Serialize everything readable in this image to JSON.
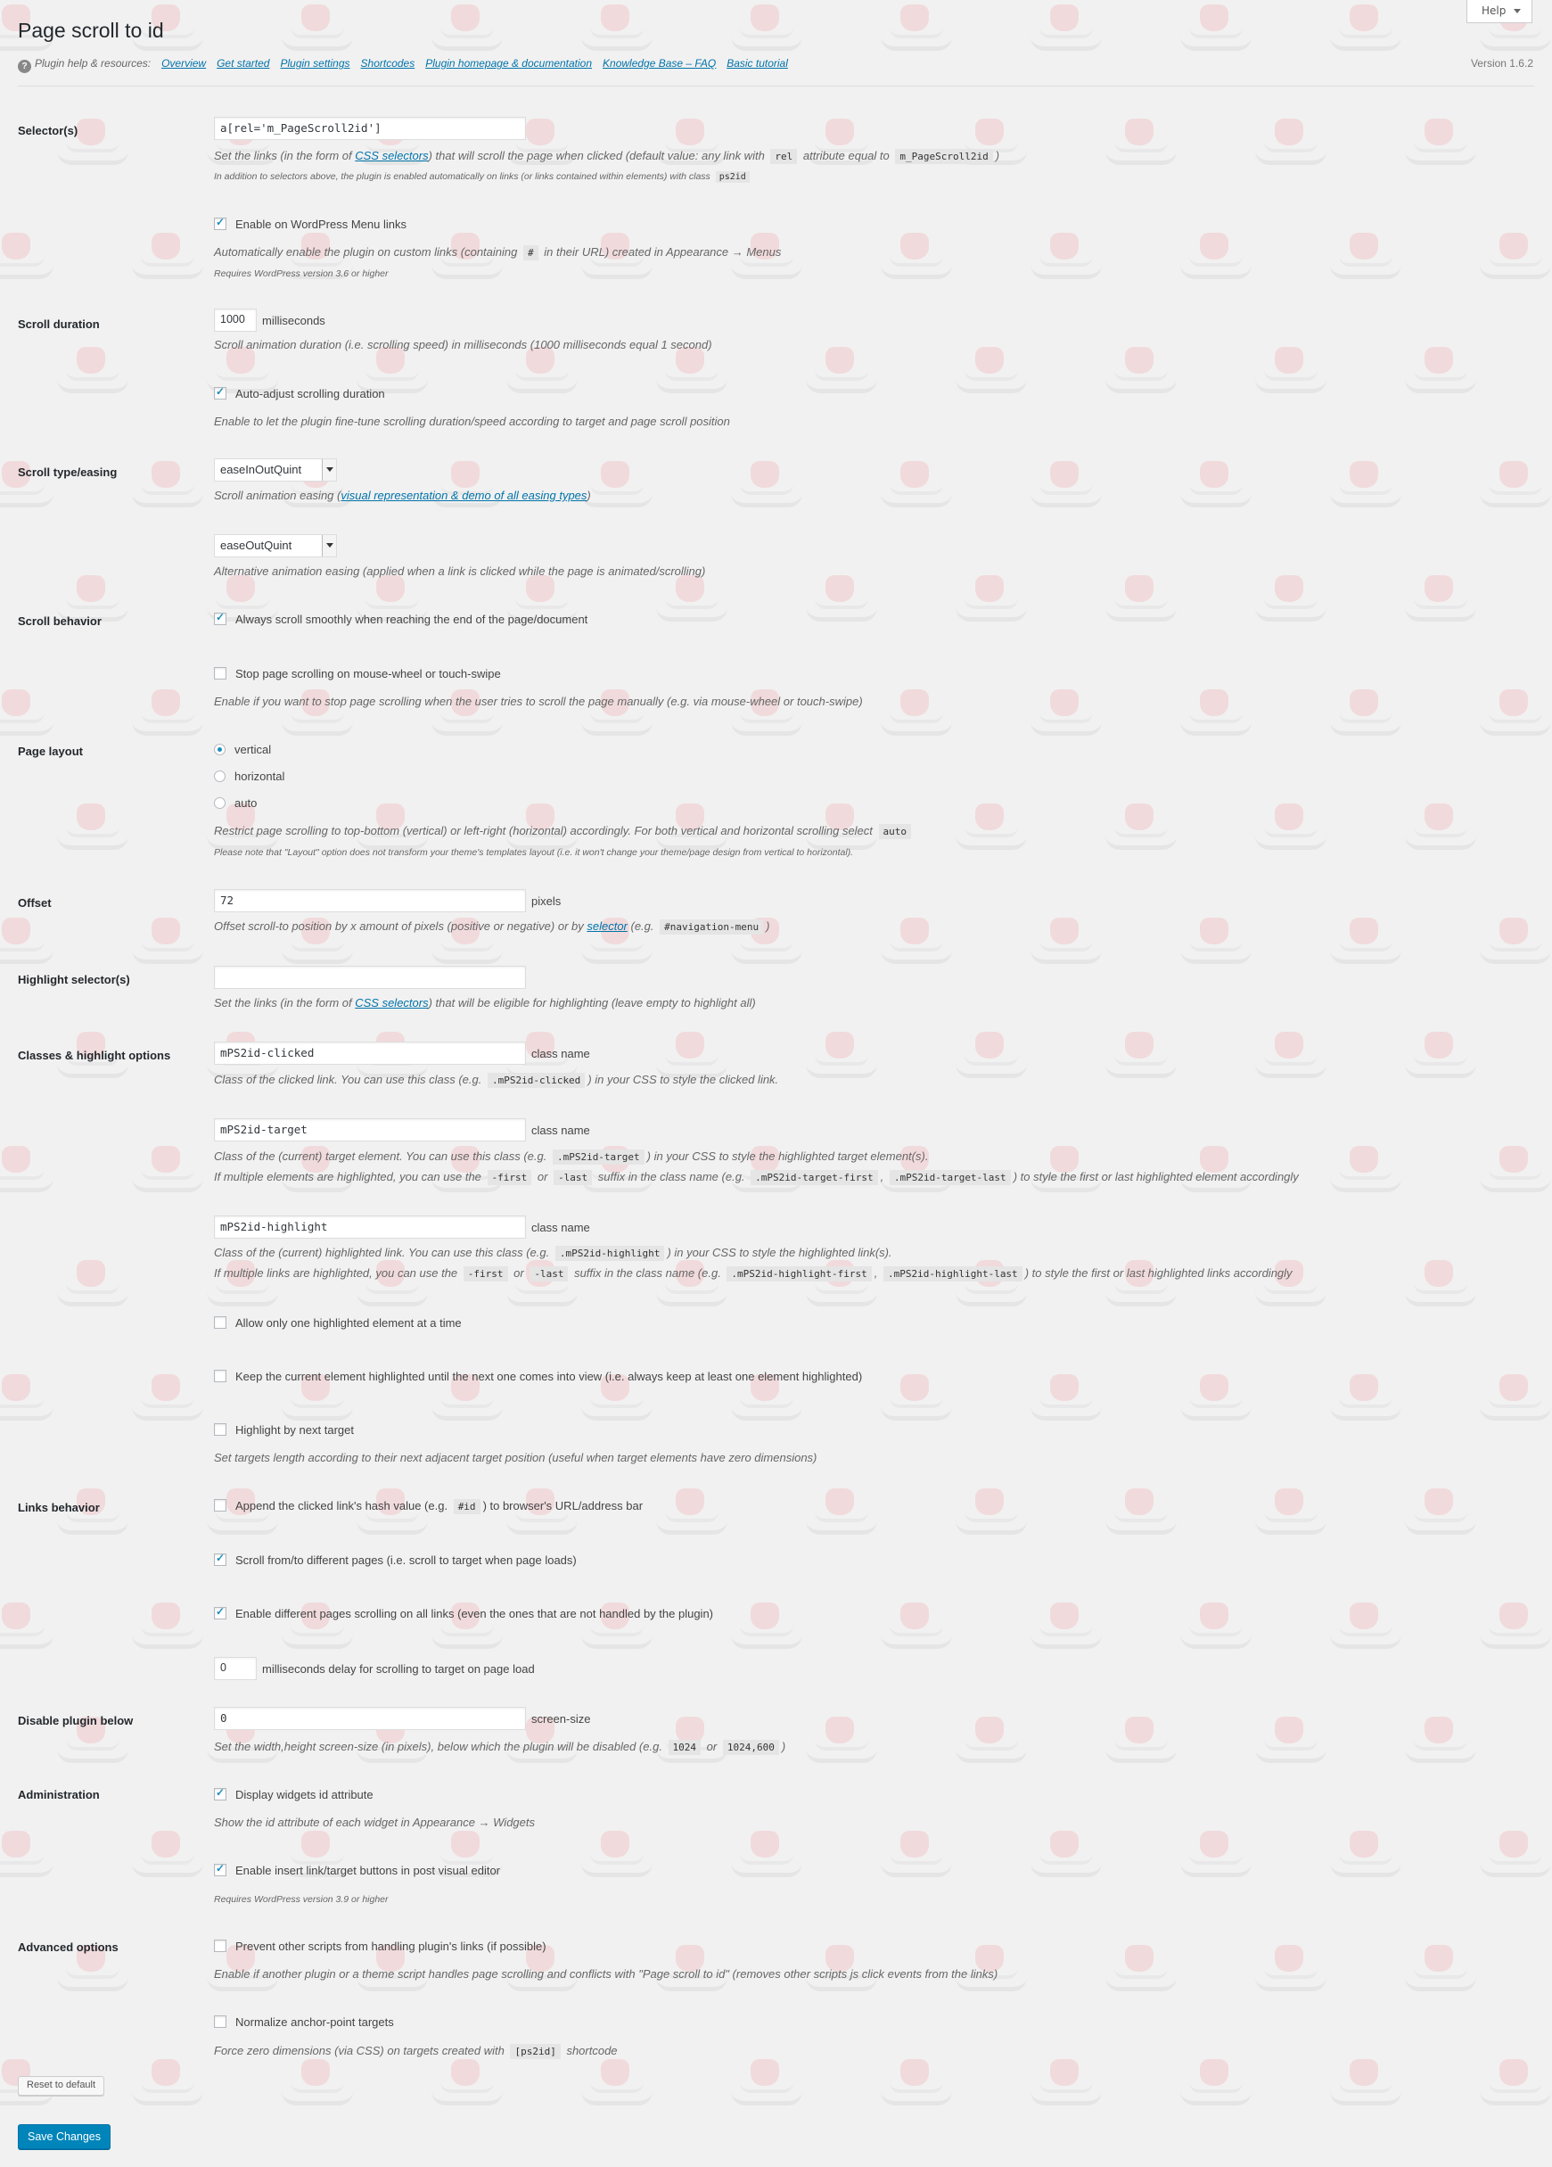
{
  "header": {
    "help_label": "Help",
    "title": "Page scroll to id",
    "resources_label": "Plugin help & resources:",
    "links": [
      "Overview",
      "Get started",
      "Plugin settings",
      "Shortcodes",
      "Plugin homepage & documentation",
      "Knowledge Base – FAQ",
      "Basic tutorial"
    ],
    "version": "Version 1.6.2"
  },
  "selectors": {
    "label": "Selector(s)",
    "value": "a[rel='m_PageScroll2id']",
    "desc_a": "Set the links (in the form of ",
    "desc_link": "CSS selectors",
    "desc_b": ") that will scroll the page when clicked (default value: any link with ",
    "code_rel": "rel",
    "desc_c": " attribute equal to ",
    "code_val": "m_PageScroll2id",
    "desc_d": ")",
    "note_a": "In addition to selectors above, the plugin is enabled automatically on links (or links contained within elements) with class ",
    "note_code": "ps2id"
  },
  "wp_menu": {
    "label": "Enable on WordPress Menu links",
    "checked": true,
    "desc_a": "Automatically enable the plugin on custom links (containing ",
    "desc_code": "#",
    "desc_b": " in their URL) created in Appearance → Menus",
    "note": "Requires WordPress version 3.6 or higher"
  },
  "duration": {
    "label": "Scroll duration",
    "value": "1000",
    "unit": "milliseconds",
    "desc": "Scroll animation duration (i.e. scrolling speed) in milliseconds (1000 milliseconds equal 1 second)",
    "auto_label": "Auto-adjust scrolling duration",
    "auto_checked": true,
    "auto_desc": "Enable to let the plugin fine-tune scrolling duration/speed according to target and page scroll position"
  },
  "easing": {
    "label": "Scroll type/easing",
    "value": "easeInOutQuint",
    "desc_a": "Scroll animation easing (",
    "desc_link": "visual representation & demo of all easing types",
    "desc_b": ")",
    "alt_value": "easeOutQuint",
    "alt_desc": "Alternative animation easing (applied when a link is clicked while the page is animated/scrolling)"
  },
  "behavior": {
    "label": "Scroll behavior",
    "smooth_label": "Always scroll smoothly when reaching the end of the page/document",
    "smooth_checked": true,
    "stop_label": "Stop page scrolling on mouse-wheel or touch-swipe",
    "stop_checked": false,
    "stop_desc": "Enable if you want to stop page scrolling when the user tries to scroll the page manually (e.g. via mouse-wheel or touch-swipe)"
  },
  "layout": {
    "label": "Page layout",
    "options": [
      "vertical",
      "horizontal",
      "auto"
    ],
    "selected": "vertical",
    "desc_a": "Restrict page scrolling to top-bottom (vertical) or left-right (horizontal) accordingly. For both vertical and horizontal scrolling select ",
    "desc_code": "auto",
    "note": "Please note that \"Layout\" option does not transform your theme's templates layout (i.e. it won't change your theme/page design from vertical to horizontal)."
  },
  "offset": {
    "label": "Offset",
    "value": "72",
    "unit": "pixels",
    "desc_a": "Offset scroll-to position by x amount of pixels (positive or negative) or by ",
    "desc_link": "selector",
    "desc_b": " (e.g. ",
    "desc_code": "#navigation-menu",
    "desc_c": ")"
  },
  "highlight_sel": {
    "label": "Highlight selector(s)",
    "value": "",
    "desc_a": "Set the links (in the form of ",
    "desc_link": "CSS selectors",
    "desc_b": ") that will be eligible for highlighting (leave empty to highlight all)"
  },
  "classes": {
    "label": "Classes & highlight options",
    "unit": "class name",
    "clicked_value": "mPS2id-clicked",
    "clicked_desc_a": "Class of the clicked link. You can use this class (e.g. ",
    "clicked_code": ".mPS2id-clicked",
    "clicked_desc_b": ") in your CSS to style the clicked link.",
    "target_value": "mPS2id-target",
    "target_desc_a": "Class of the (current) target element. You can use this class (e.g. ",
    "target_code": ".mPS2id-target",
    "target_desc_b": ") in your CSS to style the highlighted target element(s).",
    "target_desc2_a": "If multiple elements are highlighted, you can use the ",
    "code_first": "-first",
    "or": " or ",
    "code_last": "-last",
    "target_desc2_b": " suffix in the class name (e.g. ",
    "target_code_first": ".mPS2id-target-first",
    "comma": ", ",
    "target_code_last": ".mPS2id-target-last",
    "target_desc2_c": ") to style the first or last highlighted element accordingly",
    "highlight_value": "mPS2id-highlight",
    "highlight_desc_a": "Class of the (current) highlighted link. You can use this class (e.g. ",
    "highlight_code": ".mPS2id-highlight",
    "highlight_desc_b": ") in your CSS to style the highlighted link(s).",
    "highlight_desc2_a": "If multiple links are highlighted, you can use the ",
    "highlight_desc2_b": " suffix in the class name (e.g. ",
    "highlight_code_first": ".mPS2id-highlight-first",
    "highlight_code_last": ".mPS2id-highlight-last",
    "highlight_desc2_c": ") to style the first or last highlighted links accordingly",
    "one_label": "Allow only one highlighted element at a time",
    "one_checked": false,
    "keep_label": "Keep the current element highlighted until the next one comes into view (i.e. always keep at least one element highlighted)",
    "keep_checked": false,
    "next_label": "Highlight by next target",
    "next_checked": false,
    "next_desc": "Set targets length according to their next adjacent target position (useful when target elements have zero dimensions)"
  },
  "links": {
    "label": "Links behavior",
    "hash_a": "Append the clicked link's hash value (e.g. ",
    "hash_code": "#id",
    "hash_b": ") to browser's URL/address bar",
    "hash_checked": false,
    "pages_label": "Scroll from/to different pages (i.e. scroll to target when page loads)",
    "pages_checked": true,
    "all_label": "Enable different pages scrolling on all links (even the ones that are not handled by the plugin)",
    "all_checked": true,
    "delay_value": "0",
    "delay_unit": "milliseconds delay for scrolling to target on page load"
  },
  "disable": {
    "label": "Disable plugin below",
    "value": "0",
    "unit": "screen-size",
    "desc_a": "Set the width,height screen-size (in pixels), below which the plugin will be disabled (e.g. ",
    "code_a": "1024",
    "or": " or ",
    "code_b": "1024,600",
    "desc_b": ")"
  },
  "admin": {
    "label": "Administration",
    "widgets_label": "Display widgets id attribute",
    "widgets_checked": true,
    "widgets_desc": "Show the id attribute of each widget in Appearance → Widgets",
    "editor_label": "Enable insert link/target buttons in post visual editor",
    "editor_checked": true,
    "editor_note": "Requires WordPress version 3.9 or higher"
  },
  "advanced": {
    "label": "Advanced options",
    "prevent_label": "Prevent other scripts from handling plugin's links (if possible)",
    "prevent_checked": false,
    "prevent_desc": "Enable if another plugin or a theme script handles page scrolling and conflicts with \"Page scroll to id\" (removes other scripts js click events from the links)",
    "normalize_label": "Normalize anchor-point targets",
    "normalize_checked": false,
    "normalize_desc_a": "Force zero dimensions (via CSS) on targets created with ",
    "normalize_code": "[ps2id]",
    "normalize_desc_b": " shortcode"
  },
  "buttons": {
    "reset": "Reset to default",
    "save": "Save Changes"
  },
  "colors": {
    "primary": "#0085ba",
    "link": "#0073aa",
    "checkmark": "#1e8cbe",
    "background": "#f1f1f1"
  }
}
